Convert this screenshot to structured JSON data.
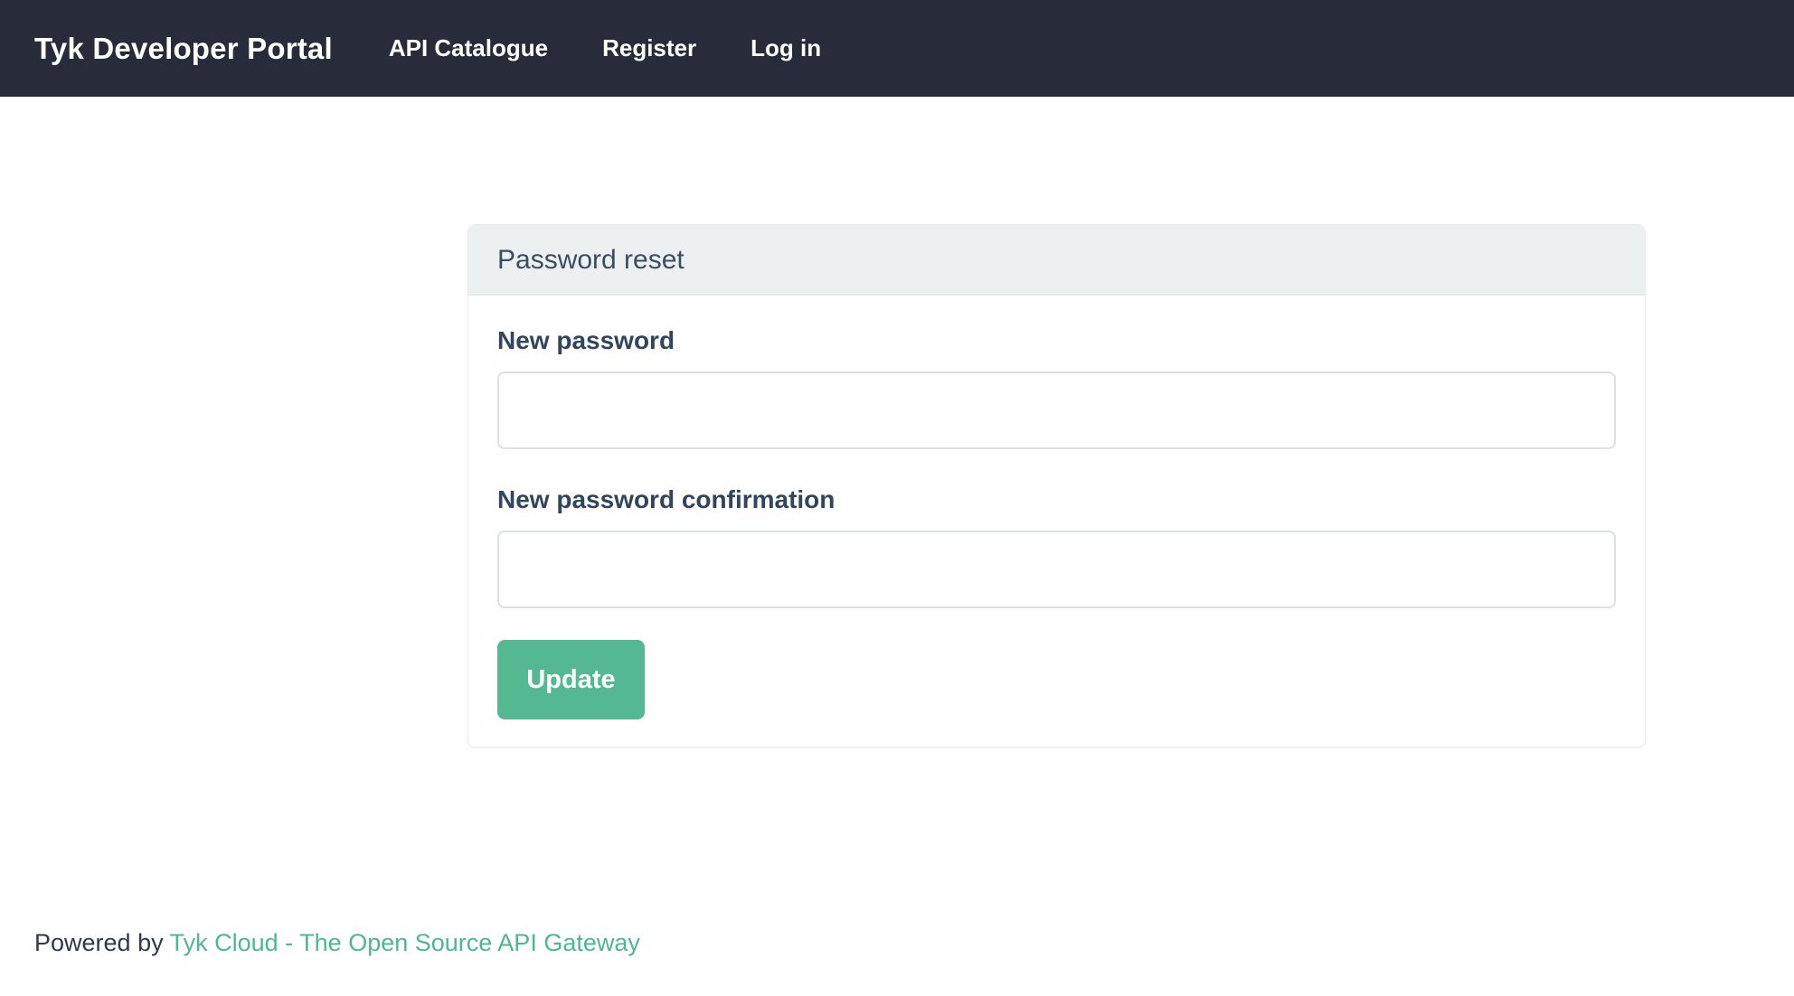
{
  "navbar": {
    "brand": "Tyk Developer Portal",
    "links": [
      {
        "label": "API Catalogue"
      },
      {
        "label": "Register"
      },
      {
        "label": "Log in"
      }
    ]
  },
  "card": {
    "title": "Password reset",
    "fields": [
      {
        "label": "New password",
        "value": ""
      },
      {
        "label": "New password confirmation",
        "value": ""
      }
    ],
    "submit_label": "Update"
  },
  "footer": {
    "prefix": "Powered by ",
    "link_text": "Tyk Cloud - The Open Source API Gateway"
  },
  "colors": {
    "navbar_bg": "#282b3a",
    "card_header_bg": "#edf0f1",
    "accent_green": "#54b892",
    "link_teal": "#4db793",
    "text_dark": "#31455c",
    "input_border": "#d9e0e9"
  }
}
